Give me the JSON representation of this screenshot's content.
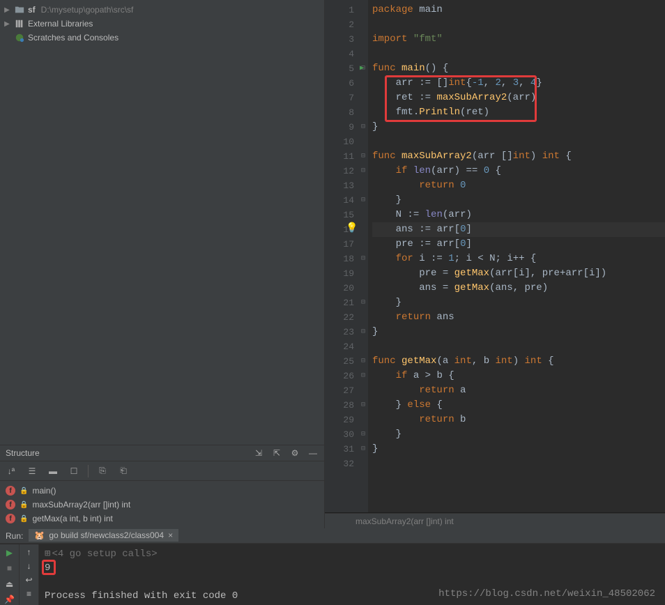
{
  "project": {
    "root": {
      "name": "sf",
      "path": "D:\\mysetup\\gopath\\src\\sf"
    },
    "external": "External Libraries",
    "scratches": "Scratches and Consoles"
  },
  "structure": {
    "title": "Structure",
    "items": [
      {
        "badge": "f",
        "label": "main()"
      },
      {
        "badge": "f",
        "label": "maxSubArray2(arr []int) int"
      },
      {
        "badge": "f",
        "label": "getMax(a int, b int) int"
      }
    ]
  },
  "editor": {
    "lines": [
      {
        "n": 1,
        "tokens": [
          [
            "kw",
            "package "
          ],
          [
            "pkg",
            "main"
          ]
        ]
      },
      {
        "n": 2,
        "tokens": []
      },
      {
        "n": 3,
        "tokens": [
          [
            "kw",
            "import "
          ],
          [
            "str",
            "\"fmt\""
          ]
        ]
      },
      {
        "n": 4,
        "tokens": []
      },
      {
        "n": 5,
        "run": true,
        "fold": "-",
        "tokens": [
          [
            "kw",
            "func "
          ],
          [
            "fn",
            "main"
          ],
          [
            "op",
            "() {"
          ]
        ]
      },
      {
        "n": 6,
        "tokens": [
          [
            "id",
            "    arr "
          ],
          [
            "op",
            ":= []"
          ],
          [
            "typ",
            "int"
          ],
          [
            "op",
            "{"
          ],
          [
            "num",
            "-1"
          ],
          [
            "op",
            ", "
          ],
          [
            "num",
            "2"
          ],
          [
            "op",
            ", "
          ],
          [
            "num",
            "3"
          ],
          [
            "op",
            ", "
          ],
          [
            "num",
            "4"
          ],
          [
            "op",
            "}"
          ]
        ]
      },
      {
        "n": 7,
        "tokens": [
          [
            "id",
            "    ret "
          ],
          [
            "op",
            ":= "
          ],
          [
            "fn",
            "maxSubArray2"
          ],
          [
            "op",
            "("
          ],
          [
            "id",
            "arr"
          ],
          [
            "op",
            ")"
          ]
        ]
      },
      {
        "n": 8,
        "tokens": [
          [
            "id",
            "    fmt"
          ],
          [
            "op",
            "."
          ],
          [
            "fn",
            "Println"
          ],
          [
            "op",
            "("
          ],
          [
            "id",
            "ret"
          ],
          [
            "op",
            ")"
          ]
        ]
      },
      {
        "n": 9,
        "fold": "-",
        "tokens": [
          [
            "op",
            "}"
          ]
        ]
      },
      {
        "n": 10,
        "tokens": []
      },
      {
        "n": 11,
        "fold": "-",
        "tokens": [
          [
            "kw",
            "func "
          ],
          [
            "fn",
            "maxSubArray2"
          ],
          [
            "op",
            "("
          ],
          [
            "id",
            "arr "
          ],
          [
            "op",
            "[]"
          ],
          [
            "typ",
            "int"
          ],
          [
            "op",
            ") "
          ],
          [
            "typ",
            "int"
          ],
          [
            "op",
            " {"
          ]
        ]
      },
      {
        "n": 12,
        "fold": "-",
        "tokens": [
          [
            "id",
            "    "
          ],
          [
            "kw",
            "if "
          ],
          [
            "builtin",
            "len"
          ],
          [
            "op",
            "("
          ],
          [
            "id",
            "arr"
          ],
          [
            "op",
            ") == "
          ],
          [
            "num",
            "0"
          ],
          [
            "op",
            " {"
          ]
        ]
      },
      {
        "n": 13,
        "tokens": [
          [
            "id",
            "        "
          ],
          [
            "kw",
            "return "
          ],
          [
            "num",
            "0"
          ]
        ]
      },
      {
        "n": 14,
        "fold": "-",
        "tokens": [
          [
            "id",
            "    "
          ],
          [
            "op",
            "}"
          ]
        ]
      },
      {
        "n": 15,
        "tokens": [
          [
            "id",
            "    N "
          ],
          [
            "op",
            ":= "
          ],
          [
            "builtin",
            "len"
          ],
          [
            "op",
            "("
          ],
          [
            "id",
            "arr"
          ],
          [
            "op",
            ")"
          ]
        ]
      },
      {
        "n": 16,
        "hl": true,
        "bulb": true,
        "tokens": [
          [
            "id",
            "    ans "
          ],
          [
            "op",
            ":= "
          ],
          [
            "id",
            "arr"
          ],
          [
            "op",
            "["
          ],
          [
            "num",
            "0"
          ],
          [
            "op",
            "]"
          ]
        ]
      },
      {
        "n": 17,
        "tokens": [
          [
            "id",
            "    pre "
          ],
          [
            "op",
            ":= "
          ],
          [
            "id",
            "arr"
          ],
          [
            "op",
            "["
          ],
          [
            "num",
            "0"
          ],
          [
            "op",
            "]"
          ]
        ]
      },
      {
        "n": 18,
        "fold": "-",
        "tokens": [
          [
            "id",
            "    "
          ],
          [
            "kw",
            "for "
          ],
          [
            "id",
            "i "
          ],
          [
            "op",
            ":= "
          ],
          [
            "num",
            "1"
          ],
          [
            "op",
            "; "
          ],
          [
            "id",
            "i"
          ],
          [
            "op",
            " < "
          ],
          [
            "id",
            "N"
          ],
          [
            "op",
            "; "
          ],
          [
            "id",
            "i"
          ],
          [
            "op",
            "++ {"
          ]
        ]
      },
      {
        "n": 19,
        "tokens": [
          [
            "id",
            "        pre "
          ],
          [
            "op",
            "= "
          ],
          [
            "fn",
            "getMax"
          ],
          [
            "op",
            "("
          ],
          [
            "id",
            "arr"
          ],
          [
            "op",
            "["
          ],
          [
            "id",
            "i"
          ],
          [
            "op",
            "], "
          ],
          [
            "id",
            "pre"
          ],
          [
            "op",
            "+"
          ],
          [
            "id",
            "arr"
          ],
          [
            "op",
            "["
          ],
          [
            "id",
            "i"
          ],
          [
            "op",
            "])"
          ]
        ]
      },
      {
        "n": 20,
        "tokens": [
          [
            "id",
            "        ans "
          ],
          [
            "op",
            "= "
          ],
          [
            "fn",
            "getMax"
          ],
          [
            "op",
            "("
          ],
          [
            "id",
            "ans"
          ],
          [
            "op",
            ", "
          ],
          [
            "id",
            "pre"
          ],
          [
            "op",
            ")"
          ]
        ]
      },
      {
        "n": 21,
        "fold": "-",
        "tokens": [
          [
            "id",
            "    "
          ],
          [
            "op",
            "}"
          ]
        ]
      },
      {
        "n": 22,
        "tokens": [
          [
            "id",
            "    "
          ],
          [
            "kw",
            "return "
          ],
          [
            "id",
            "ans"
          ]
        ]
      },
      {
        "n": 23,
        "fold": "-",
        "tokens": [
          [
            "op",
            "}"
          ]
        ]
      },
      {
        "n": 24,
        "tokens": []
      },
      {
        "n": 25,
        "fold": "-",
        "tokens": [
          [
            "kw",
            "func "
          ],
          [
            "fn",
            "getMax"
          ],
          [
            "op",
            "("
          ],
          [
            "id",
            "a "
          ],
          [
            "typ",
            "int"
          ],
          [
            "op",
            ", "
          ],
          [
            "id",
            "b "
          ],
          [
            "typ",
            "int"
          ],
          [
            "op",
            ") "
          ],
          [
            "typ",
            "int"
          ],
          [
            "op",
            " {"
          ]
        ]
      },
      {
        "n": 26,
        "fold": "-",
        "tokens": [
          [
            "id",
            "    "
          ],
          [
            "kw",
            "if "
          ],
          [
            "id",
            "a"
          ],
          [
            "op",
            " > "
          ],
          [
            "id",
            "b"
          ],
          [
            "op",
            " {"
          ]
        ]
      },
      {
        "n": 27,
        "tokens": [
          [
            "id",
            "        "
          ],
          [
            "kw",
            "return "
          ],
          [
            "id",
            "a"
          ]
        ]
      },
      {
        "n": 28,
        "fold": "-",
        "tokens": [
          [
            "id",
            "    "
          ],
          [
            "op",
            "} "
          ],
          [
            "kw",
            "else"
          ],
          [
            "op",
            " {"
          ]
        ]
      },
      {
        "n": 29,
        "tokens": [
          [
            "id",
            "        "
          ],
          [
            "kw",
            "return "
          ],
          [
            "id",
            "b"
          ]
        ]
      },
      {
        "n": 30,
        "fold": "-",
        "tokens": [
          [
            "id",
            "    "
          ],
          [
            "op",
            "}"
          ]
        ]
      },
      {
        "n": 31,
        "fold": "-",
        "tokens": [
          [
            "op",
            "}"
          ]
        ]
      },
      {
        "n": 32,
        "tokens": []
      }
    ],
    "breadcrumb": "maxSubArray2(arr []int) int"
  },
  "run": {
    "label": "Run:",
    "tab": "go build sf/newclass2/class004",
    "lines": [
      {
        "text": "<4 go setup calls>",
        "dim": true
      },
      {
        "text": "9",
        "box": true
      },
      {
        "text": ""
      },
      {
        "text": "Process finished with exit code 0"
      }
    ]
  },
  "watermark": "https://blog.csdn.net/weixin_48502062"
}
